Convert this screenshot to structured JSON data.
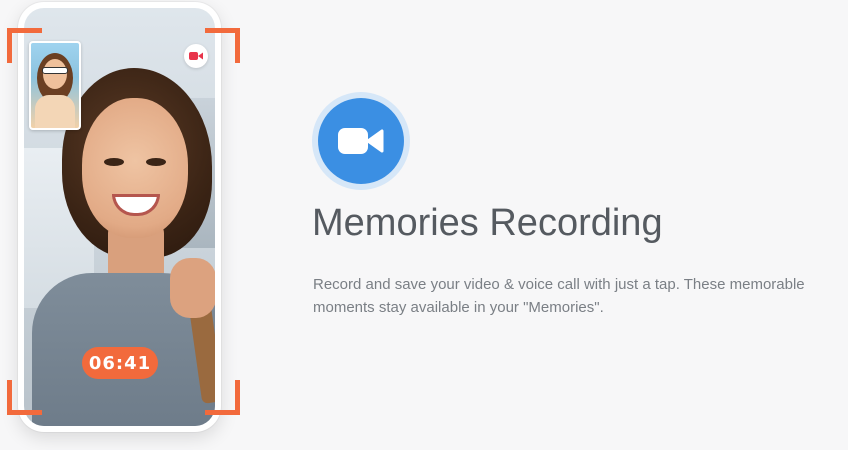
{
  "phone": {
    "timer": "06:41",
    "record_icon": "video-record-icon",
    "accent_color": "#f26a3c"
  },
  "feature": {
    "icon": "video-camera-icon",
    "icon_color": "#3b8fe3",
    "title": "Memories Recording",
    "description": "Record and save your video & voice call with just a tap. These memorable moments stay available in your \"Memories\"."
  }
}
